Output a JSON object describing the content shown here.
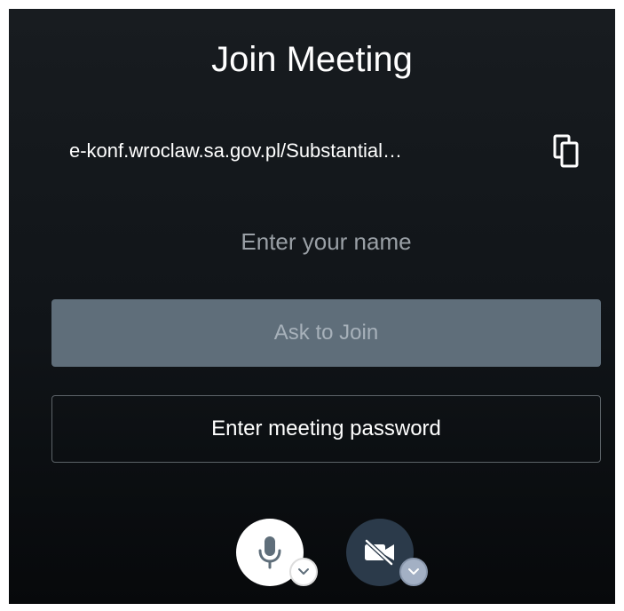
{
  "dialog": {
    "title": "Join Meeting",
    "meeting_url": "e-konf.wroclaw.sa.gov.pl/Substantial…",
    "name_placeholder": "Enter your name",
    "name_value": "",
    "join_label": "Ask to Join",
    "password_label": "Enter meeting password"
  },
  "icons": {
    "copy": "copy-icon",
    "mic": "microphone-icon",
    "camera": "camera-off-icon",
    "chevron": "chevron-down-icon"
  },
  "colors": {
    "background": "#111518",
    "join_button": "#5f6e7a",
    "camera_button": "#2b3a4a",
    "text": "#ffffff"
  }
}
